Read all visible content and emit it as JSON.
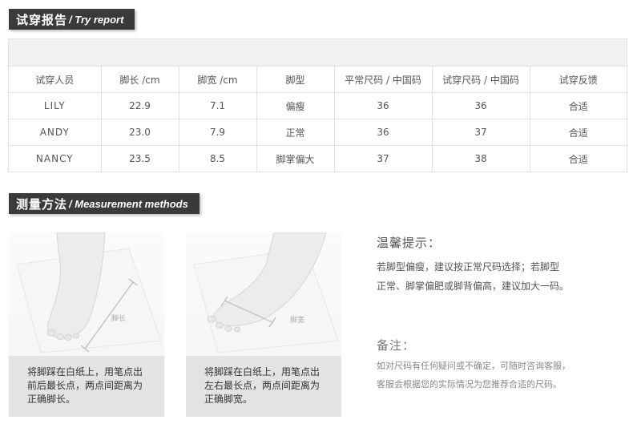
{
  "try_report": {
    "title_zh": "试穿报告",
    "title_en": "/ Try report",
    "columns": [
      "试穿人员",
      "脚长 /cm",
      "脚宽 /cm",
      "脚型",
      "平常尺码 / 中国码",
      "试穿尺码 / 中国码",
      "试穿反馈"
    ],
    "rows": [
      [
        "LILY",
        "22.9",
        "7.1",
        "偏瘦",
        "36",
        "36",
        "合适"
      ],
      [
        "ANDY",
        "23.0",
        "7.9",
        "正常",
        "36",
        "37",
        "合适"
      ],
      [
        "NANCY",
        "23.5",
        "8.5",
        "脚掌偏大",
        "37",
        "38",
        "合适"
      ]
    ]
  },
  "measurement": {
    "title_zh": "测量方法",
    "title_en": "/ Measurement methods",
    "card1_label": "脚长",
    "card1_caption": "将脚踩在白纸上，用笔点出\n前后最长点，两点间距离为\n正确脚长。",
    "card2_label": "脚宽",
    "card2_caption": "将脚踩在白纸上，用笔点出\n左右最长点，两点间距离为\n正确脚宽。"
  },
  "tips": {
    "title": "温馨提示：",
    "body": "若脚型偏瘦，建议按正常尺码选择；若脚型\n正常、脚掌偏肥或脚背偏高，建议加大一码。"
  },
  "note": {
    "title": "备注：",
    "body": "如对尺码有任何疑问或不确定，可随时咨询客服，\n客服会根据您的实际情况为您推荐合适的尺码。"
  }
}
